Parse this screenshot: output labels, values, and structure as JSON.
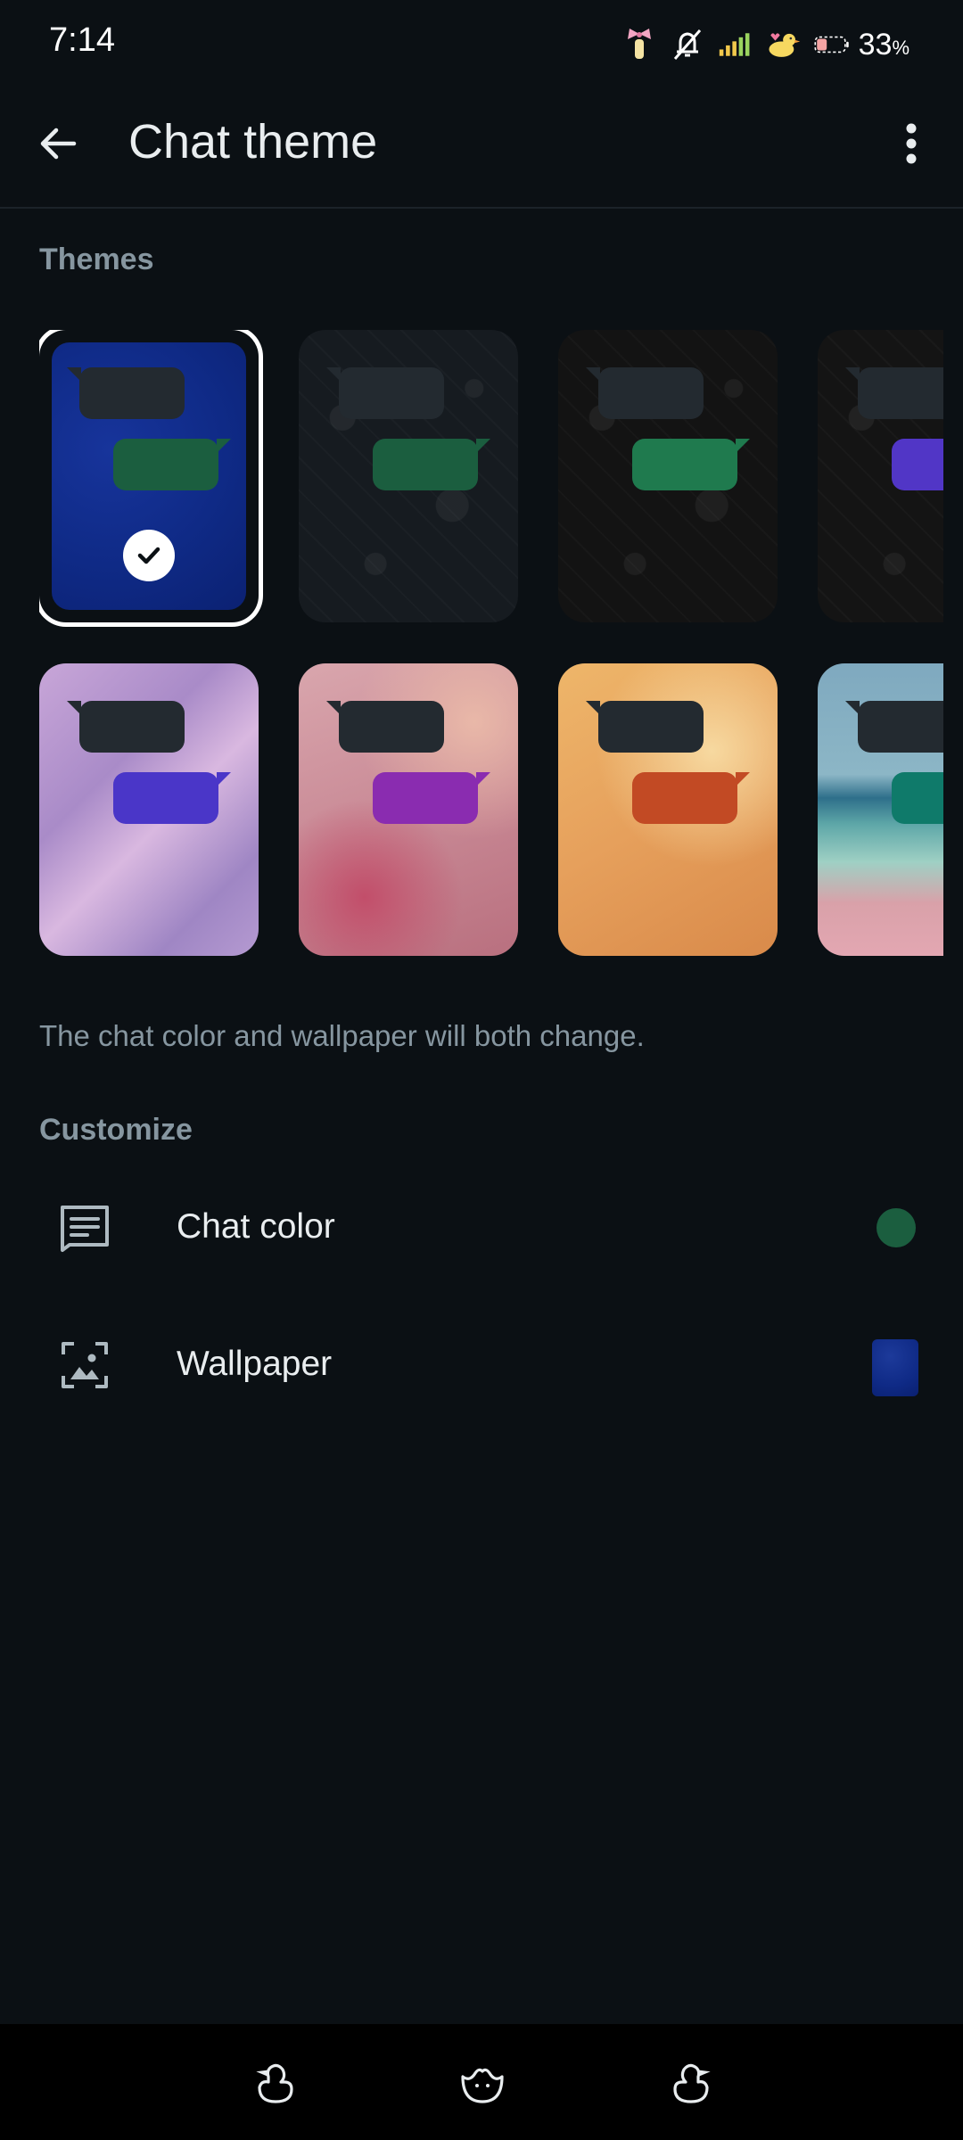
{
  "status_bar": {
    "time": "7:14",
    "battery_percent": "33",
    "battery_unit": "%",
    "icons": [
      "bow-icon",
      "mute-icon",
      "signal-icon",
      "duck-sticker-icon",
      "battery-icon"
    ]
  },
  "app_bar": {
    "title": "Chat theme",
    "back_icon": "arrow-left-icon",
    "menu_icon": "more-vert-icon"
  },
  "themes": {
    "label": "Themes",
    "selected_index": 0,
    "items": [
      {
        "name": "default-blue",
        "background": "#0f2a86",
        "bubble_color": "#1b5e3f",
        "selected": true
      },
      {
        "name": "doodle-dark",
        "background": "#161b20",
        "bubble_color": "#1b5e3f",
        "selected": false
      },
      {
        "name": "doodle-black",
        "background": "#131313",
        "bubble_color": "#1f7a4e",
        "selected": false
      },
      {
        "name": "doodle-purple",
        "background": "#141414",
        "bubble_color": "#5136c6",
        "selected": false
      },
      {
        "name": "iridescent",
        "background": "#b59ad1",
        "bubble_color": "#4a36c8",
        "selected": false
      },
      {
        "name": "blossom",
        "background": "#c98a96",
        "bubble_color": "#8a2cb0",
        "selected": false
      },
      {
        "name": "peach",
        "background": "#e6a05c",
        "bubble_color": "#c24a24",
        "selected": false
      },
      {
        "name": "beach",
        "background": "#7fb3c2",
        "bubble_color": "#0f7a6a",
        "selected": false
      }
    ]
  },
  "hint": "The chat color and wallpaper will both change.",
  "customize": {
    "label": "Customize",
    "chat_color": {
      "label": "Chat color",
      "icon": "chat-bubble-lines-icon",
      "swatch": "#1b5e3f"
    },
    "wallpaper": {
      "label": "Wallpaper",
      "icon": "wallpaper-icon",
      "swatch": "#0f2a86"
    }
  },
  "nav_bar": {
    "keys": [
      "duck-back-icon",
      "duck-home-icon",
      "duck-recents-icon"
    ]
  }
}
